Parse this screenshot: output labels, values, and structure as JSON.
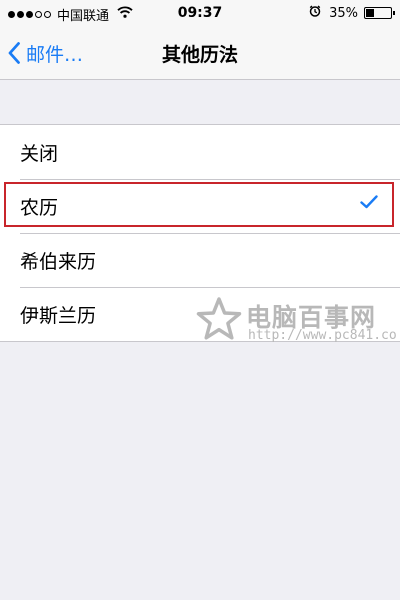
{
  "status_bar": {
    "carrier": "中国联通",
    "time": "09:37",
    "battery_percent": "35%",
    "battery_level": 0.35,
    "signal_bars_filled": 3,
    "signal_bars_total": 5
  },
  "nav": {
    "back_label": "邮件…",
    "title": "其他历法"
  },
  "list": {
    "items": [
      {
        "label": "关闭",
        "selected": false
      },
      {
        "label": "农历",
        "selected": true
      },
      {
        "label": "希伯来历",
        "selected": false
      },
      {
        "label": "伊斯兰历",
        "selected": false
      }
    ]
  },
  "watermark": {
    "name": "电脑百事网",
    "url": "http://www.pc841.co"
  },
  "colors": {
    "accent": "#1a7cf5",
    "highlight": "#c8252b",
    "background": "#efeff4",
    "separator": "#c8c7cc"
  }
}
